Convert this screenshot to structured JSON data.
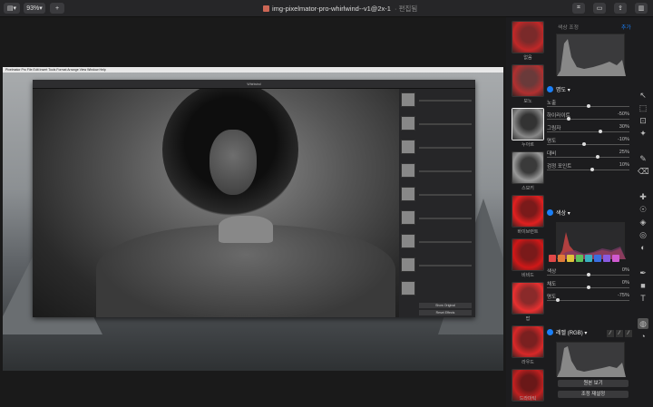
{
  "toolbar": {
    "zoom_label": "93%",
    "add_label": "+",
    "doc_title": "img-pixelmator-pro-whirlwind--v1@2x-1",
    "doc_subtitle": "· 편집됨"
  },
  "inner_app": {
    "menubar": "Pixelmator Pro  File  Edit  Insert  Tools  Format  Arrange  View  Window  Help",
    "window_title": "Whirlwind",
    "buttons": [
      "Show Original",
      "Reset Effects"
    ]
  },
  "presets": {
    "items": [
      {
        "label": "없음",
        "selected": false
      },
      {
        "label": "모노",
        "selected": false
      },
      {
        "label": "누아르",
        "selected": true
      },
      {
        "label": "스모키",
        "selected": false
      },
      {
        "label": "바이브런트",
        "selected": false
      },
      {
        "label": "비비드",
        "selected": false
      },
      {
        "label": "팝",
        "selected": false
      },
      {
        "label": "라우드",
        "selected": false
      },
      {
        "label": "드라마틱",
        "selected": false
      }
    ]
  },
  "adjust": {
    "tabs": [
      "색상 조정",
      "추가"
    ],
    "light": {
      "title": "명도",
      "rows": [
        {
          "label": "노출",
          "value": "",
          "level": 0.5
        },
        {
          "label": "하이라이트",
          "value": "-50%",
          "level": 0.25
        },
        {
          "label": "그림자",
          "value": "30%",
          "level": 0.65
        },
        {
          "label": "명도",
          "value": "-10%",
          "level": 0.45
        },
        {
          "label": "대비",
          "value": "25%",
          "level": 0.62
        },
        {
          "label": "검정 포인트",
          "value": "10%",
          "level": 0.55
        }
      ]
    },
    "color": {
      "title": "색상",
      "rows": [
        {
          "label": "색상",
          "value": "0%",
          "level": 0.5
        },
        {
          "label": "채도",
          "value": "0%",
          "level": 0.5
        },
        {
          "label": "명도",
          "value": "-75%",
          "level": 0.12
        }
      ],
      "swatches": [
        "#e04848",
        "#e07a3a",
        "#e0c23a",
        "#5cc05c",
        "#3ab0c0",
        "#3a6ee0",
        "#8a5ae0",
        "#d05ad0"
      ]
    },
    "curves": {
      "title": "레벨 (RGB)"
    },
    "buttons": [
      "원본 보기",
      "조정 재설정"
    ]
  },
  "colors": {
    "accent": "#1a7ff7",
    "panel": "#1c1c1e"
  }
}
